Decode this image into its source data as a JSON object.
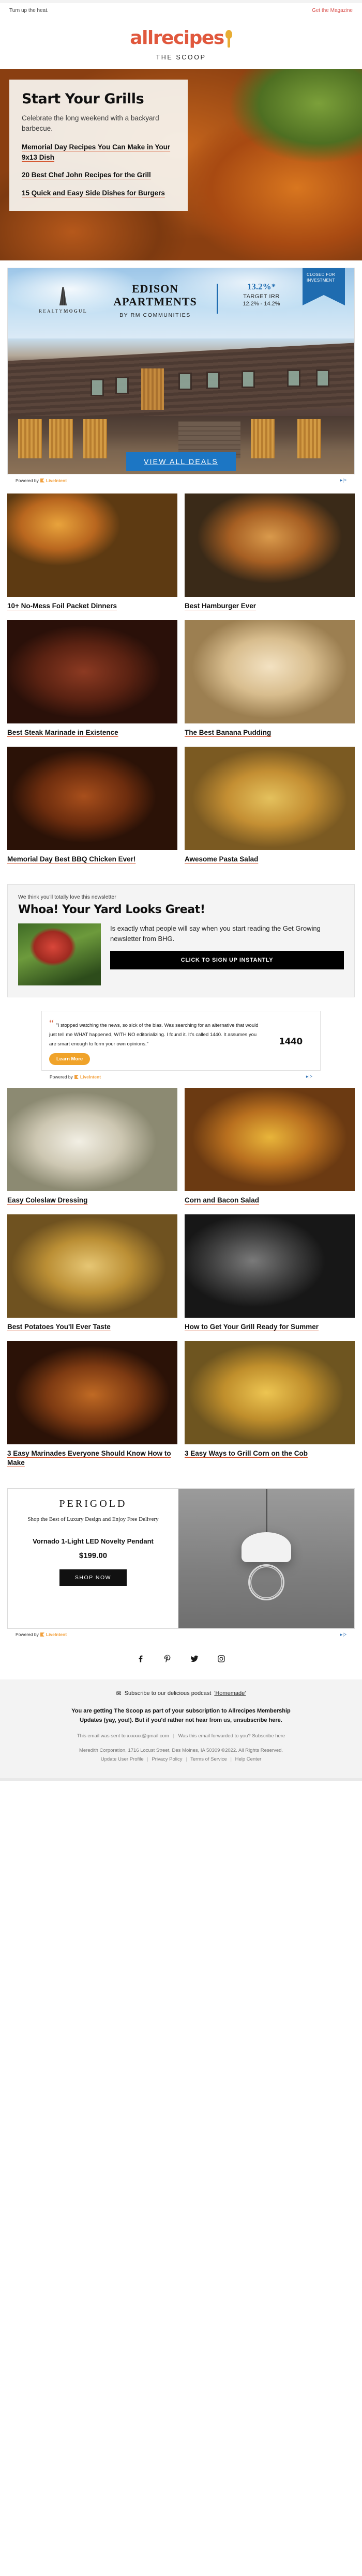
{
  "preheader": {
    "left": "Turn up the heat.",
    "right": "Get the Magazine"
  },
  "brand": {
    "logo_text": "allrecipes",
    "logo_color": "#e0583d",
    "spoon_color": "#e8ad34",
    "tagline": "THE SCOOP"
  },
  "hero": {
    "title": "Start Your Grills",
    "subtitle": "Celebrate the long weekend with a backyard barbecue.",
    "links": [
      "Memorial Day Recipes You Can Make in Your 9x13 Dish",
      "20 Best Chef John Recipes for the Grill",
      "15 Quick and Easy Side Dishes for Burgers"
    ]
  },
  "ad_edison": {
    "sponsor_logo": "REALTYMOGUL",
    "sponsor_logo_light": "REALTY",
    "sponsor_logo_bold": "MOGUL",
    "title_line1": "EDISON",
    "title_line2": "APARTMENTS",
    "subtitle": "BY RM COMMUNITIES",
    "irr_value": "13.2%*",
    "irr_label": "TARGET IRR",
    "irr_range": "12.2% - 14.2%",
    "ribbon_line1": "CLOSED FOR",
    "ribbon_line2": "INVESTMENT",
    "cta": "VIEW ALL DEALS",
    "accent_color": "#1f6cb0"
  },
  "powered_by": {
    "prefix": "Powered by",
    "name": "LiveIntent",
    "adchoices": "AdChoices"
  },
  "recipes": [
    {
      "caption": "10+ No-Mess Foil Packet Dinners",
      "photo_class": "ph-foil"
    },
    {
      "caption": "Best Hamburger Ever",
      "photo_class": "ph-burger"
    },
    {
      "caption": "Best Steak Marinade in Existence",
      "photo_class": "ph-steak"
    },
    {
      "caption": "The Best Banana Pudding",
      "photo_class": "ph-pud"
    },
    {
      "caption": "Memorial Day Best BBQ Chicken Ever!",
      "photo_class": "ph-bbq"
    },
    {
      "caption": "Awesome Pasta Salad",
      "photo_class": "ph-pasta"
    }
  ],
  "promo": {
    "eyebrow": "We think you'll totally love this newsletter",
    "headline": "Whoa! Your Yard Looks Great!",
    "body": "Is exactly what people will say when you start reading the Get Growing newsletter from BHG.",
    "cta": "CLICK TO SIGN UP INSTANTLY"
  },
  "ad_quote": {
    "quote": "\"I stopped watching the news, so sick of the bias. Was searching for an alternative that would just tell me WHAT happened, WITH NO editorializing. I found it. It's called 1440. It assumes you are smart enough to form your own opinions.\"",
    "quote_bold": "WHAT happened, WITH NO editorializing.",
    "cta": "Learn More",
    "logo": "1440",
    "accent_color": "#f0a32a"
  },
  "recipes2": [
    {
      "caption": "Easy Coleslaw Dressing",
      "photo_class": "ph-slaw"
    },
    {
      "caption": "Corn and Bacon Salad",
      "photo_class": "ph-corn"
    },
    {
      "caption": "Best Potatoes You'll Ever Taste",
      "photo_class": "ph-pot"
    },
    {
      "caption": "How to Get Your Grill Ready for Summer",
      "photo_class": "ph-grill"
    },
    {
      "caption": "3 Easy Marinades Everyone Should Know How to Make",
      "photo_class": "ph-mar"
    },
    {
      "caption": "3 Easy Ways to Grill Corn on the Cob",
      "photo_class": "ph-cob"
    }
  ],
  "ad_perigold": {
    "brand": "PERIGOLD",
    "tagline": "Shop the Best of Luxury Design and Enjoy Free Delivery",
    "product": "Vornado 1-Light LED Novelty Pendant",
    "price": "$199.00",
    "cta": "SHOP NOW"
  },
  "social": {
    "items": [
      {
        "name": "facebook-icon",
        "label": "Facebook"
      },
      {
        "name": "pinterest-icon",
        "label": "Pinterest"
      },
      {
        "name": "twitter-icon",
        "label": "Twitter"
      },
      {
        "name": "instagram-icon",
        "label": "Instagram"
      }
    ]
  },
  "footer": {
    "subscribe_prefix": "Subscribe to our delicious podcast",
    "subscribe_link": "'Homemade'",
    "note_line1": "You are getting The Scoop as part of your subscription to Allrecipes Membership",
    "note_line2": "Updates (yay, you!). But if you'd rather not hear from us, unsubscribe here.",
    "sent_to_prefix": "This email was sent to",
    "sent_to_email": "xxxxxx@gmail.com",
    "forwarded_text": "Was this email forwarded to you? Subscribe here",
    "legal": "Meredith Corporation, 1716 Locust Street, Des Moines, IA 50309 ©2022. All Rights Reserved.",
    "links": [
      "Update User Profile",
      "Privacy Policy",
      "Terms of Service",
      "Help Center"
    ]
  }
}
